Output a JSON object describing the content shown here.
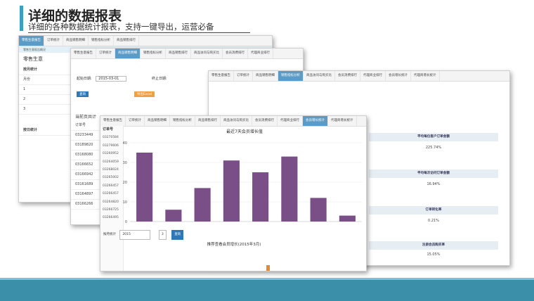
{
  "slide": {
    "title": "详细的数据报表",
    "subtitle": "详细的各种数据统计报表，支持一键导出，运营必备"
  },
  "window_a": {
    "tabs": [
      "零售生意报告",
      "订单统计",
      "商品销售明细",
      "销售指标分析",
      "商品销售排行"
    ],
    "info": "零售生意报告概况",
    "labels": {
      "title": "零售生意",
      "by_month": "按月统计",
      "month_col": "月份",
      "rows": [
        "1",
        "2",
        "3"
      ],
      "by_day": "按日统计"
    }
  },
  "window_b": {
    "tabs": [
      "零售生意报告",
      "订单统计",
      "商品销售明细",
      "销售指标分析",
      "商品销售排行",
      "商品访问与购买比",
      "会员消费排行",
      "代理商业排行"
    ],
    "labels": {
      "start_date": "起始日期:",
      "start_value": "2015-03-01",
      "end_date": "终止日期:",
      "query": "查询",
      "export": "导出Excel",
      "member_title": "当前页共计"
    },
    "order_ids": [
      "订单号",
      "03233449",
      "03189820",
      "03168080",
      "03166652",
      "03166942",
      "03161689",
      "03164897",
      "03166266"
    ]
  },
  "window_c": {
    "tabs": [
      "零售生意报告",
      "订单统计",
      "商品销售明细",
      "销售指标分析",
      "商品访问与购买比",
      "会员消费排行",
      "代理商业排行",
      "会员增长统计",
      "代理商增长统计"
    ],
    "metrics": [
      {
        "label": "平均每位客户订单金额",
        "value": "225.74%"
      },
      {
        "label": "平均每次访问订单金额",
        "value": "16.94%"
      },
      {
        "label": "订单转化率",
        "value": "0.21%"
      },
      {
        "label": "注册会员购买率",
        "value": "15.05%"
      }
    ]
  },
  "window_d": {
    "tabs": [
      "零售生意报告",
      "订单统计",
      "商品销售明细",
      "销售指标分析",
      "商品销售排行",
      "商品访问与购买比",
      "会员消费排行",
      "代理商业排行",
      "会员增长统计",
      "代理商增长统计"
    ],
    "order_ids": [
      "订单号",
      "03270584",
      "03279606",
      "03260952",
      "03264059",
      "03268024",
      "03265002",
      "03266457",
      "03266457",
      "03264820",
      "03266725",
      "03266495"
    ],
    "month_bar": {
      "label": "按月统计",
      "year": "2015",
      "month": "3",
      "query": "查询"
    },
    "chart2_title": "推荐查看会员增长(2015年3月)"
  },
  "chart_data": {
    "type": "bar",
    "title": "最近7天会员增长值",
    "categories": [
      "",
      "",
      "",
      "",
      "",
      "",
      "",
      ""
    ],
    "values": [
      35,
      6,
      17,
      31,
      25,
      33,
      12,
      3
    ],
    "ylim": [
      0,
      40
    ],
    "yticks": [
      "0",
      "10",
      "20",
      "30",
      "40"
    ],
    "grid": true,
    "bar_color": "#7a4e86"
  },
  "colors": {
    "accent": "#3aa0c0",
    "footer": "#3b8fa8",
    "tab_active": "#5a9cc7"
  }
}
